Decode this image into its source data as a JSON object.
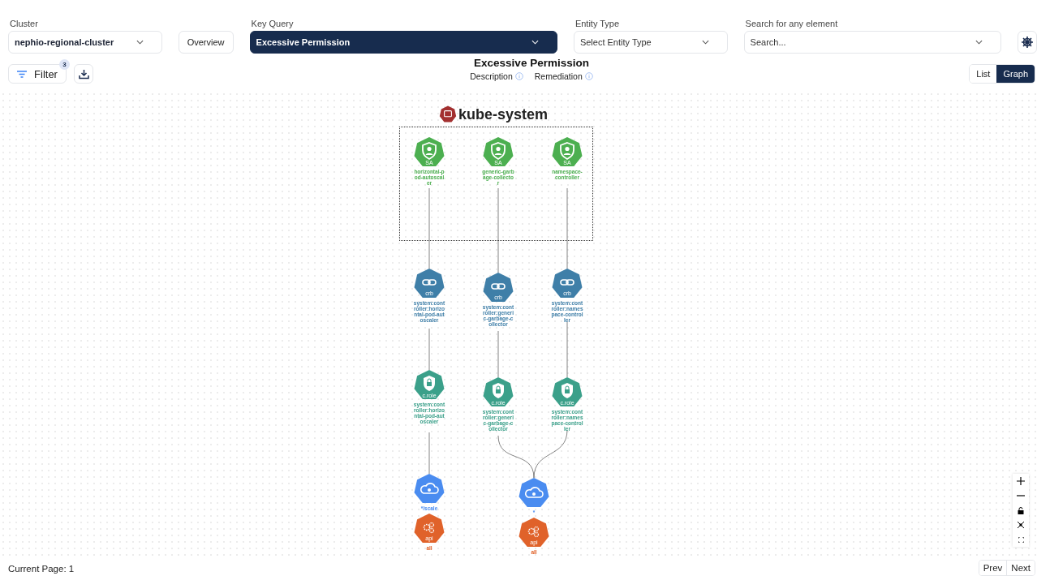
{
  "cluster": {
    "label": "Cluster",
    "value": "nephio-regional-cluster"
  },
  "overview_button": "Overview",
  "key_query": {
    "label": "Key Query",
    "value": "Excessive Permission"
  },
  "entity_type": {
    "label": "Entity Type",
    "placeholder": "Select Entity Type"
  },
  "search": {
    "label": "Search for any element",
    "placeholder": "Search..."
  },
  "filter": {
    "label": "Filter",
    "count": "3"
  },
  "title": "Excessive Permission",
  "info_links": [
    "Description",
    "Remediation"
  ],
  "view_toggle": [
    {
      "label": "List",
      "selected": false
    },
    {
      "label": "Graph",
      "selected": true
    }
  ],
  "graph": {
    "namespace": "kube-system",
    "groups": [
      {
        "chains": [
          {
            "account": {
              "badge": "SA",
              "label": "horizontal-pod-autoscaler"
            },
            "binding": {
              "badge": "crb",
              "label": "system:controller:horizontal-pod-autoscaler"
            },
            "role": {
              "badge": "c.role",
              "label": "system:controller:horizontal-pod-autoscaler"
            }
          }
        ],
        "resource": {
          "label": "*/scale"
        },
        "api": {
          "badge": "api",
          "label": "all"
        }
      },
      {
        "chains": [
          {
            "account": {
              "badge": "SA",
              "label": "generic-garbage-collector"
            },
            "binding": {
              "badge": "crb",
              "label": "system:controller:generic-garbage-collector"
            },
            "role": {
              "badge": "c.role",
              "label": "system:controller:generic-garbage-collector"
            }
          },
          {
            "account": {
              "badge": "SA",
              "label": "namespace-controller"
            },
            "binding": {
              "badge": "crb",
              "label": "system:controller:namespace-controller"
            },
            "role": {
              "badge": "c.role",
              "label": "system:controller:namespace-controller"
            }
          }
        ],
        "resource": {
          "label": "*"
        },
        "api": {
          "badge": "api",
          "label": "all"
        }
      }
    ]
  },
  "footer": {
    "page": "Current Page: 1",
    "buttons": [
      "Prev",
      "Next"
    ]
  }
}
